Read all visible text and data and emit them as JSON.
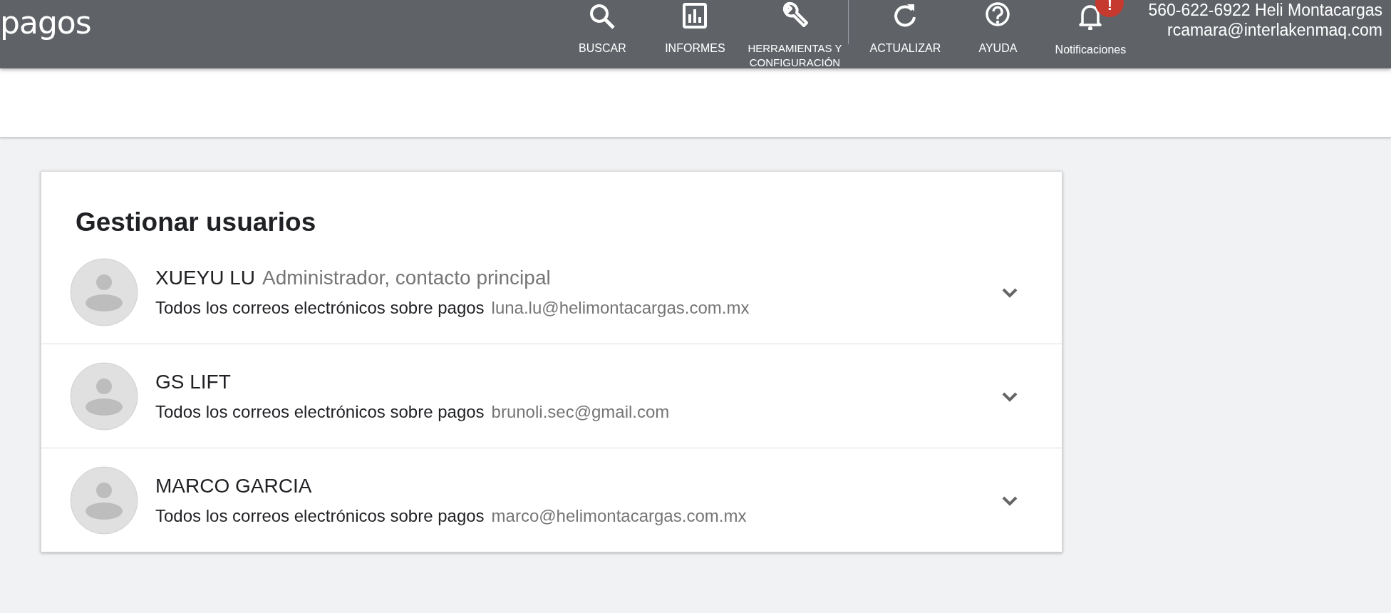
{
  "header": {
    "title": "pagos",
    "nav": [
      {
        "kind": "search",
        "label": "BUSCAR"
      },
      {
        "kind": "report",
        "label": "INFORMES"
      },
      {
        "kind": "tools",
        "label": "HERRAMIENTAS Y CONFIGURACIÓN"
      },
      {
        "kind": "refresh",
        "label": "ACTUALIZAR"
      },
      {
        "kind": "help",
        "label": "AYUDA"
      },
      {
        "kind": "bell",
        "label": "Notificaciones",
        "badge": "!"
      }
    ],
    "account": {
      "line_1": "560-622-6922 Heli Montacargas",
      "line_2": "rcamara@interlakenmaq.com"
    }
  },
  "card": {
    "title": "Gestionar usuarios",
    "users": [
      {
        "name": "XUEYU LU",
        "role": "Administrador, contacto principal",
        "subscription": "Todos los correos electrónicos sobre pagos",
        "email": "luna.lu@helimontacargas.com.mx",
        "expanded": false
      },
      {
        "name": "GS LIFT",
        "subscription": "Todos los correos electrónicos sobre pagos",
        "email": "brunoli.sec@gmail.com",
        "expanded": false
      },
      {
        "name": "MARCO GARCIA",
        "subscription": "Todos los correos electrónicos sobre pagos",
        "email": "marco@helimontacargas.com.mx",
        "expanded": false
      }
    ]
  }
}
